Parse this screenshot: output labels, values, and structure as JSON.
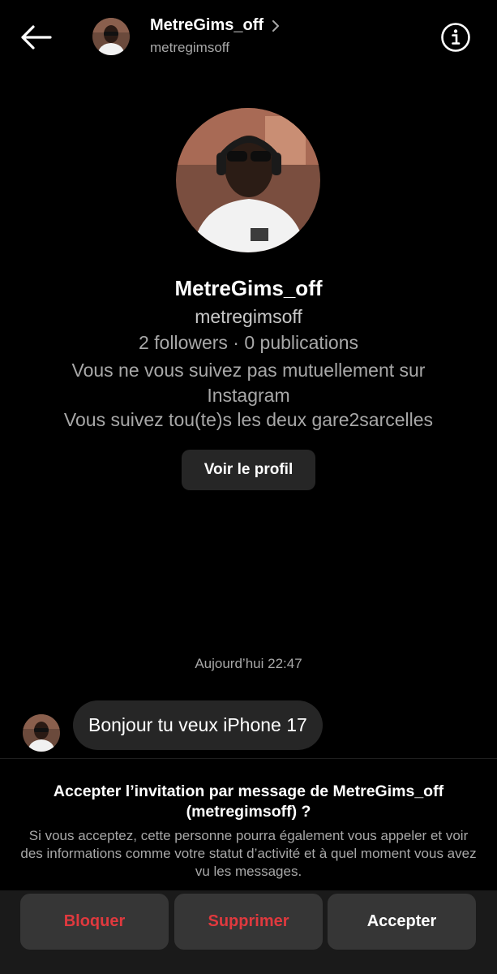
{
  "header": {
    "name": "MetreGims_off",
    "username": "metregimsoff"
  },
  "profile": {
    "name": "MetreGims_off",
    "username": "metregimsoff",
    "stats": "2 followers · 0 publications",
    "mutual": "Vous ne vous suivez pas mutuellement sur Instagram",
    "common_follow": "Vous suivez tou(te)s les deux gare2sarcelles",
    "view_profile_label": "Voir le profil"
  },
  "conversation": {
    "timestamp": "Aujourd’hui 22:47",
    "messages": [
      {
        "text": "Bonjour tu veux iPhone 17"
      }
    ]
  },
  "request": {
    "title": "Accepter l’invitation par message de MetreGims_off (metregimsoff) ?",
    "description": "Si vous acceptez, cette personne pourra également vous appeler et voir des informations comme votre statut d’activité et à quel moment vous avez vu les messages.",
    "buttons": {
      "block": "Bloquer",
      "delete": "Supprimer",
      "accept": "Accepter"
    }
  },
  "colors": {
    "background": "#000000",
    "bubble": "#262626",
    "danger": "#e0393e",
    "muted": "#a8a8a8"
  }
}
